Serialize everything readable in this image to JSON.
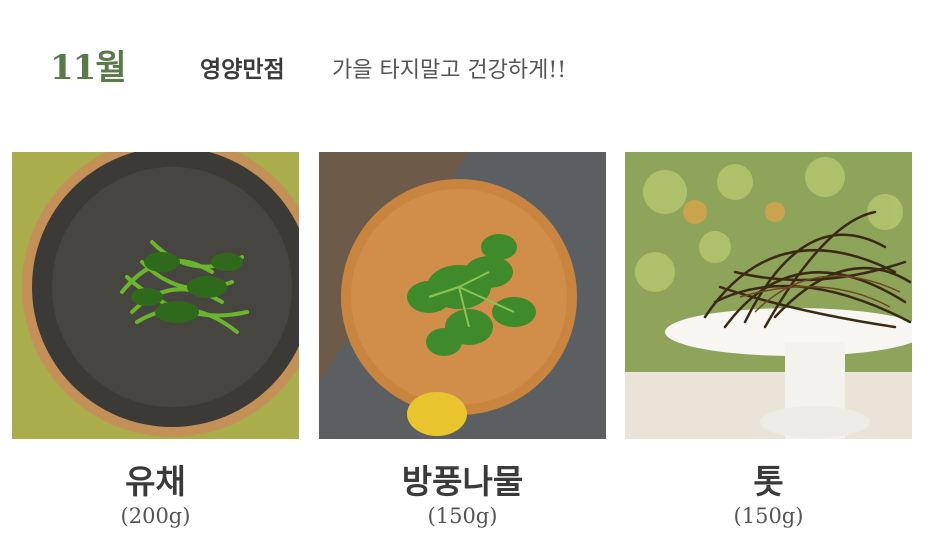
{
  "header": {
    "month": "11월",
    "title": "영양만점",
    "subtitle": "가을 타지말고 건강하게!!"
  },
  "items": [
    {
      "name": "유채",
      "weight": "(200g)",
      "photo": "seasoned rapeseed greens on a dark plate"
    },
    {
      "name": "방풍나물",
      "weight": "(150g)",
      "photo": "fresh siler leaves on a wooden board"
    },
    {
      "name": "톳",
      "weight": "(150g)",
      "photo": "hijiki seaweed on a white pedestal dish"
    }
  ]
}
